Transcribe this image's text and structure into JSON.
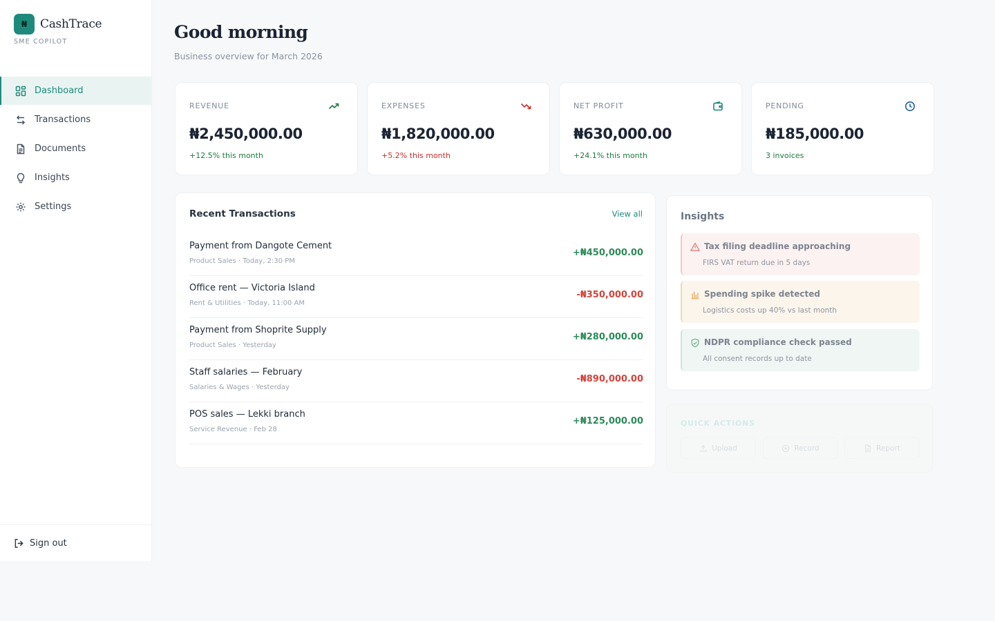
{
  "brand": {
    "name": "CashTrace",
    "tagline": "SME COPILOT",
    "logo_glyph": "₦",
    "accent": "#1e8a7c"
  },
  "sidebar": {
    "items": [
      {
        "label": "Dashboard",
        "icon": "dashboard-grid-icon",
        "active": true
      },
      {
        "label": "Transactions",
        "icon": "arrows-swap-icon"
      },
      {
        "label": "Documents",
        "icon": "document-icon"
      },
      {
        "label": "Insights",
        "icon": "lightbulb-icon"
      },
      {
        "label": "Settings",
        "icon": "gear-icon"
      }
    ],
    "signout_label": "Sign out"
  },
  "header": {
    "greeting": "Good morning",
    "subtitle": "Business overview for March 2026"
  },
  "kpis": [
    {
      "label": "REVENUE",
      "value": "₦2,450,000.00",
      "delta": "+12.5% this month",
      "icon": "trending-up-icon",
      "delta_color": "#1f7a3f"
    },
    {
      "label": "EXPENSES",
      "value": "₦1,820,000.00",
      "delta": "+5.2% this month",
      "icon": "trending-down-icon",
      "delta_color": "#c6302b"
    },
    {
      "label": "NET PROFIT",
      "value": "₦630,000.00",
      "delta": "+24.1% this month",
      "icon": "wallet-icon",
      "delta_color": "#1f7a3f"
    },
    {
      "label": "PENDING",
      "value": "₦185,000.00",
      "delta": "3 invoices",
      "icon": "clock-icon",
      "delta_color": "#1f7a3f"
    }
  ],
  "transactions": {
    "title": "Recent Transactions",
    "view_all": "View all",
    "rows": [
      {
        "name": "Payment from Dangote Cement",
        "meta": "Product Sales · Today, 2:30 PM",
        "amount": "+₦450,000.00",
        "direction": "in"
      },
      {
        "name": "Office rent — Victoria Island",
        "meta": "Rent & Utilities · Today, 11:00 AM",
        "amount": "-₦350,000.00",
        "direction": "out"
      },
      {
        "name": "Payment from Shoprite Supply",
        "meta": "Product Sales · Yesterday",
        "amount": "+₦280,000.00",
        "direction": "in"
      },
      {
        "name": "Staff salaries — February",
        "meta": "Salaries & Wages · Yesterday",
        "amount": "-₦890,000.00",
        "direction": "out"
      },
      {
        "name": "POS sales — Lekki branch",
        "meta": "Service Revenue · Feb 28",
        "amount": "+₦125,000.00",
        "direction": "in"
      }
    ]
  },
  "insights": {
    "title": "Insights",
    "items": [
      {
        "title": "Tax filing deadline approaching",
        "detail": "FIRS VAT return due in 5 days",
        "icon": "warning-triangle-icon",
        "tone": "red"
      },
      {
        "title": "Spending spike detected",
        "detail": "Logistics costs up 40% vs last month",
        "icon": "bar-chart-icon",
        "tone": "amber"
      },
      {
        "title": "NDPR compliance check passed",
        "detail": "All consent records up to date",
        "icon": "shield-check-icon",
        "tone": "green"
      }
    ]
  },
  "quick_actions": {
    "title": "QUICK ACTIONS",
    "buttons": [
      {
        "label": "Upload",
        "icon": "upload-icon"
      },
      {
        "label": "Record",
        "icon": "plus-circle-icon"
      },
      {
        "label": "Report",
        "icon": "report-icon"
      }
    ]
  }
}
